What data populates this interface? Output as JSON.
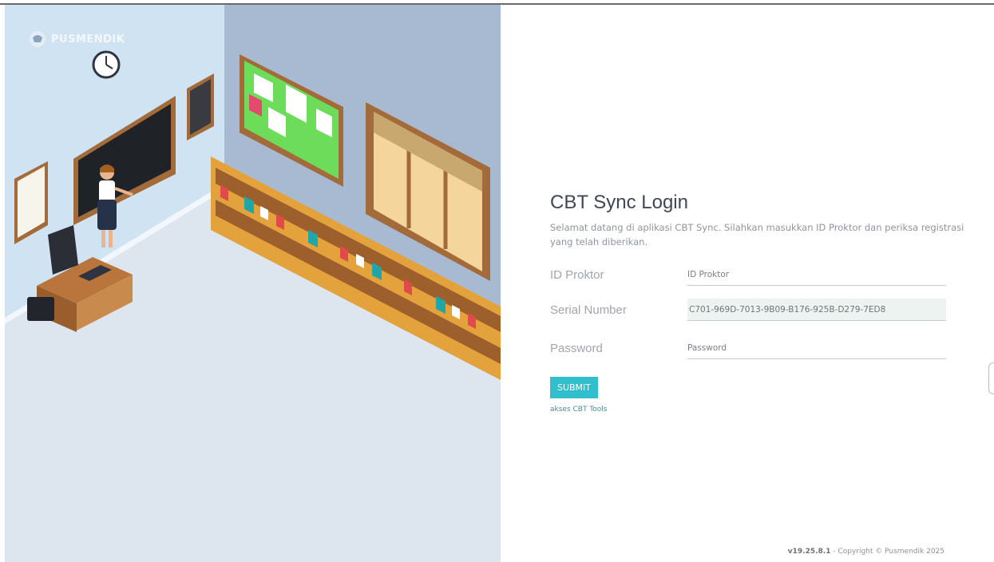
{
  "brand": {
    "logo_text": "PUSMENDIK",
    "logo_icon": "garuda-emblem-icon"
  },
  "login": {
    "title": "CBT Sync Login",
    "description": "Selamat datang di aplikasi CBT Sync. Silahkan masukkan ID Proktor dan periksa registrasi yang telah diberikan.",
    "fields": [
      {
        "label": "ID Proktor",
        "placeholder": "ID Proktor",
        "value": ""
      },
      {
        "label": "Serial Number",
        "placeholder": "",
        "value": "C701-969D-7013-9B09-B176-925B-D279-7ED8"
      },
      {
        "label": "Password",
        "placeholder": "Password",
        "value": ""
      }
    ],
    "submit_label": "SUBMIT",
    "tools_link": "akses CBT Tools"
  },
  "footer": {
    "version": "v19.25.8.1",
    "copyright": " - Copyright © Pusmendik 2025"
  },
  "colors": {
    "accent": "#32bfcd",
    "title": "#3f4756",
    "wall_left": "#cfe3f3",
    "wall_right": "#a7bad2"
  }
}
